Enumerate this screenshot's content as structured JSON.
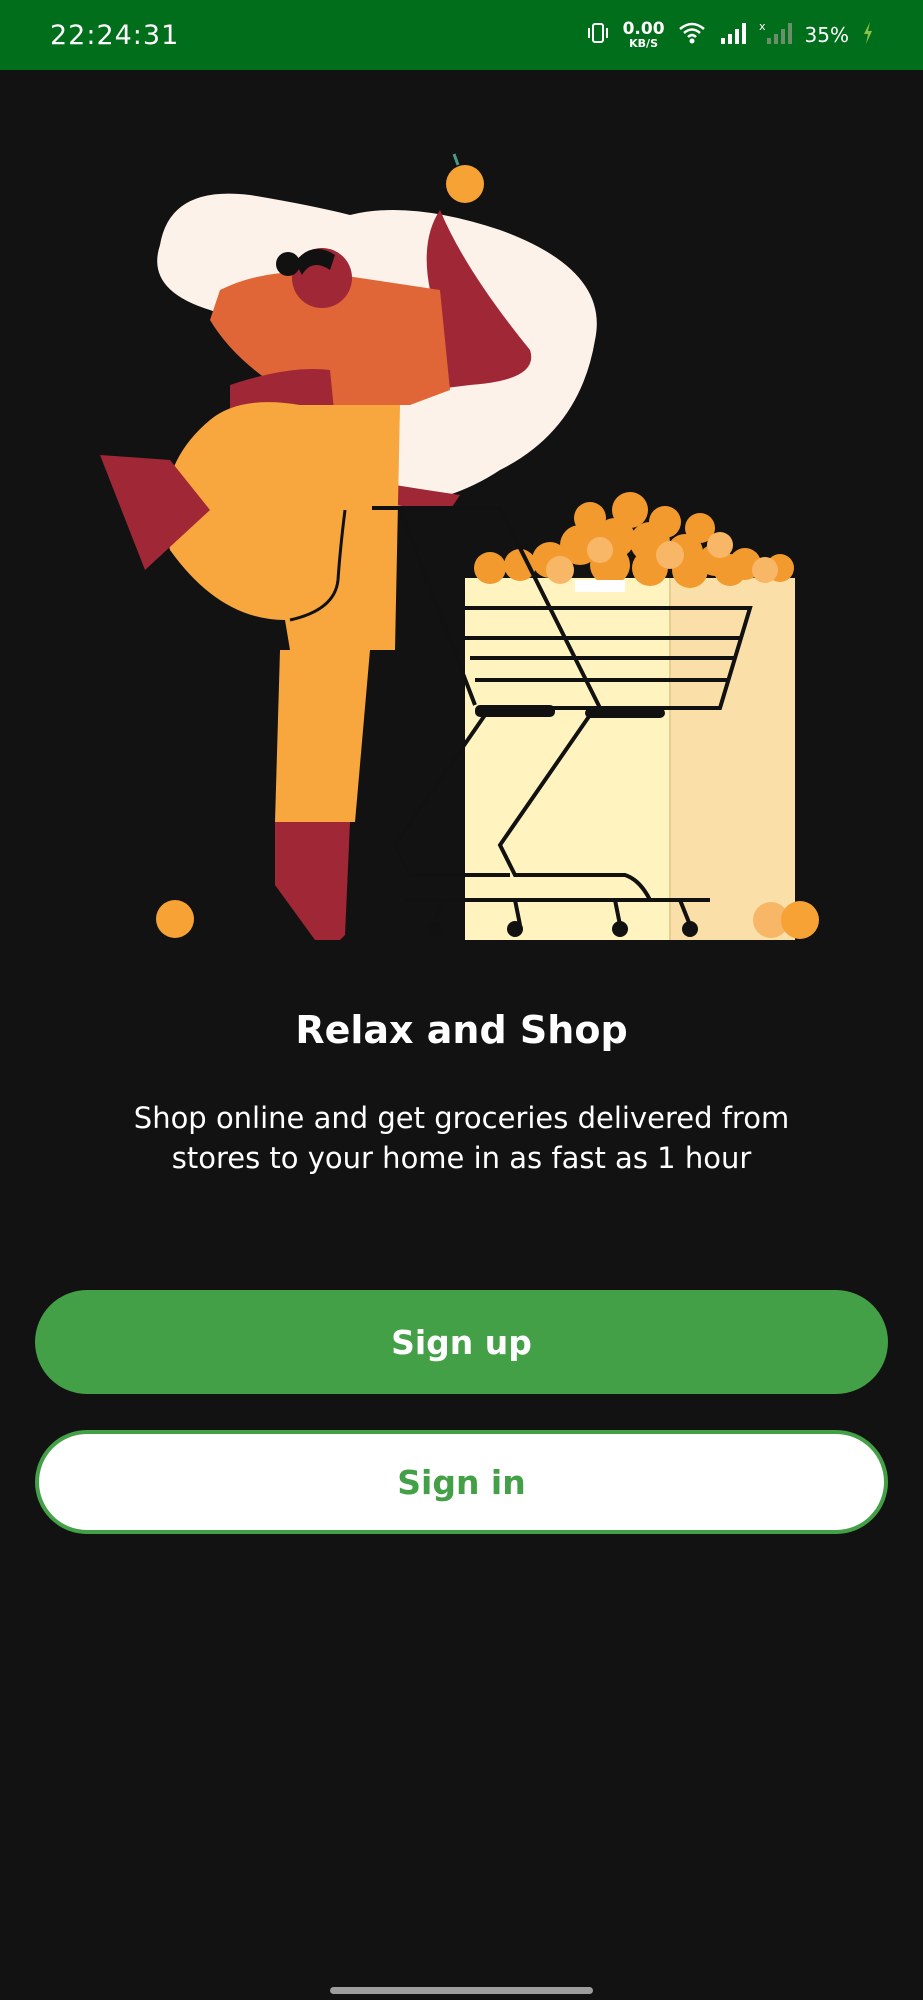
{
  "status_bar": {
    "time": "22:24:31",
    "net_speed_value": "0.00",
    "net_speed_unit": "KB/S",
    "battery": "35%",
    "icons": [
      "vibrate-icon",
      "wifi-icon",
      "signal-icon",
      "no-signal-icon",
      "charging-icon"
    ]
  },
  "onboarding": {
    "title": "Relax and Shop",
    "subtitle": "Shop online and get groceries delivered from stores to your home in as fast as 1 hour"
  },
  "actions": {
    "signup_label": "Sign up",
    "signin_label": "Sign in"
  },
  "colors": {
    "status_bar": "#006e1a",
    "background": "#121212",
    "accent": "#43a047"
  }
}
